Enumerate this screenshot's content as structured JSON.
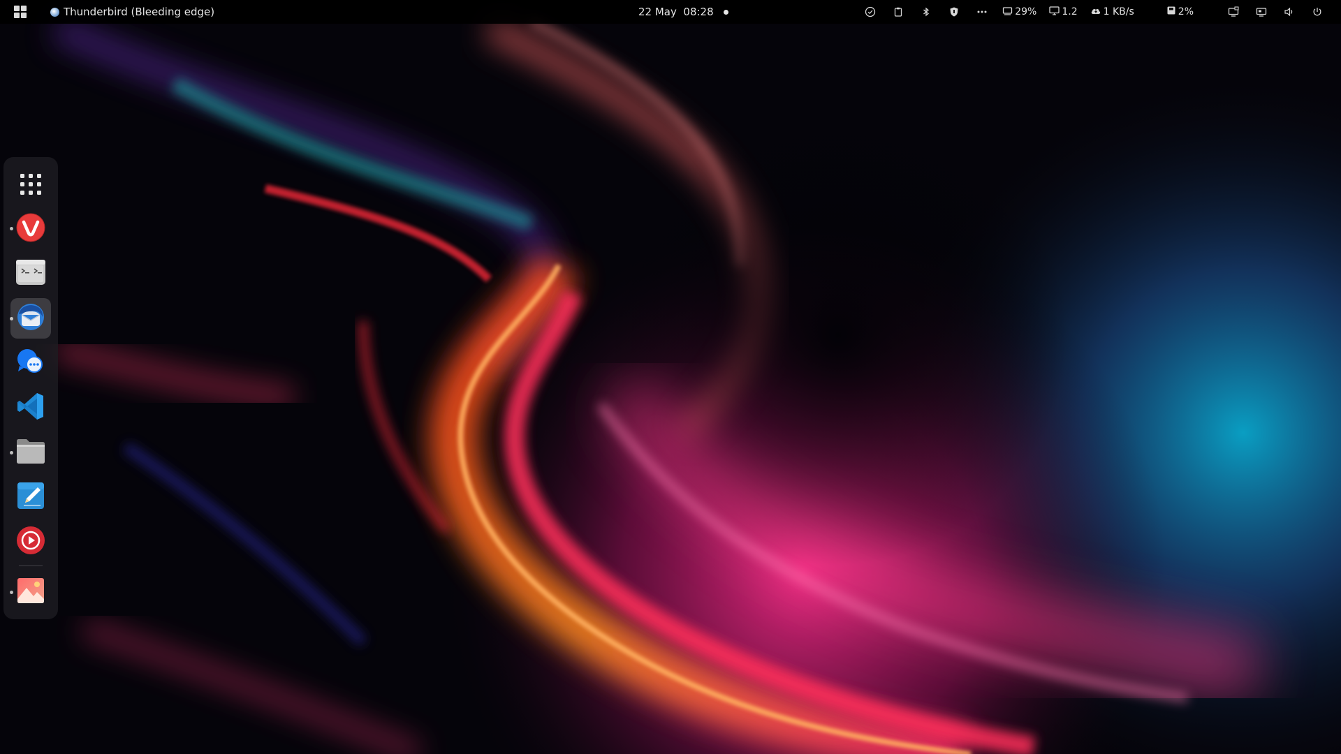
{
  "topbar": {
    "activities_icon": "activities-grid-icon",
    "active_app_icon": "thunderbird-icon",
    "active_app_title": "Thunderbird (Bleeding edge)",
    "clock": "22 May  08:28",
    "tray": {
      "icons": [
        "checkmark-circle-icon",
        "clipboard-icon",
        "bluetooth-icon",
        "shield-icon",
        "more-dots-icon"
      ],
      "cpu_value": "29%",
      "load_value": "1.2",
      "network_value": "1 KB/s",
      "disk_value": "2%",
      "system_icons": [
        "display-icon",
        "screen-share-icon",
        "volume-icon",
        "power-icon"
      ]
    }
  },
  "dock": {
    "items": [
      {
        "name": "show-apps",
        "icon": "app-grid-icon",
        "running": false,
        "active": false
      },
      {
        "name": "vivaldi",
        "icon": "vivaldi-icon",
        "running": true,
        "active": false
      },
      {
        "name": "terminal",
        "icon": "terminal-icon",
        "running": false,
        "active": false
      },
      {
        "name": "thunderbird",
        "icon": "thunderbird-icon",
        "running": true,
        "active": true
      },
      {
        "name": "messenger",
        "icon": "chat-bubble-icon",
        "running": false,
        "active": false
      },
      {
        "name": "vscode",
        "icon": "vscode-icon",
        "running": false,
        "active": false
      },
      {
        "name": "files",
        "icon": "folder-icon",
        "running": true,
        "active": false
      },
      {
        "name": "text-editor",
        "icon": "pencil-note-icon",
        "running": false,
        "active": false
      },
      {
        "name": "media-player",
        "icon": "play-circle-icon",
        "running": false,
        "active": false
      },
      {
        "name": "image-viewer",
        "icon": "image-icon",
        "running": true,
        "active": false
      }
    ]
  },
  "colors": {
    "topbar_bg": "#000000",
    "dock_bg": "#1e1e22",
    "accent_orange": "#ff7a1a",
    "accent_pink": "#ff2a7a",
    "accent_teal": "#00a0c8"
  }
}
